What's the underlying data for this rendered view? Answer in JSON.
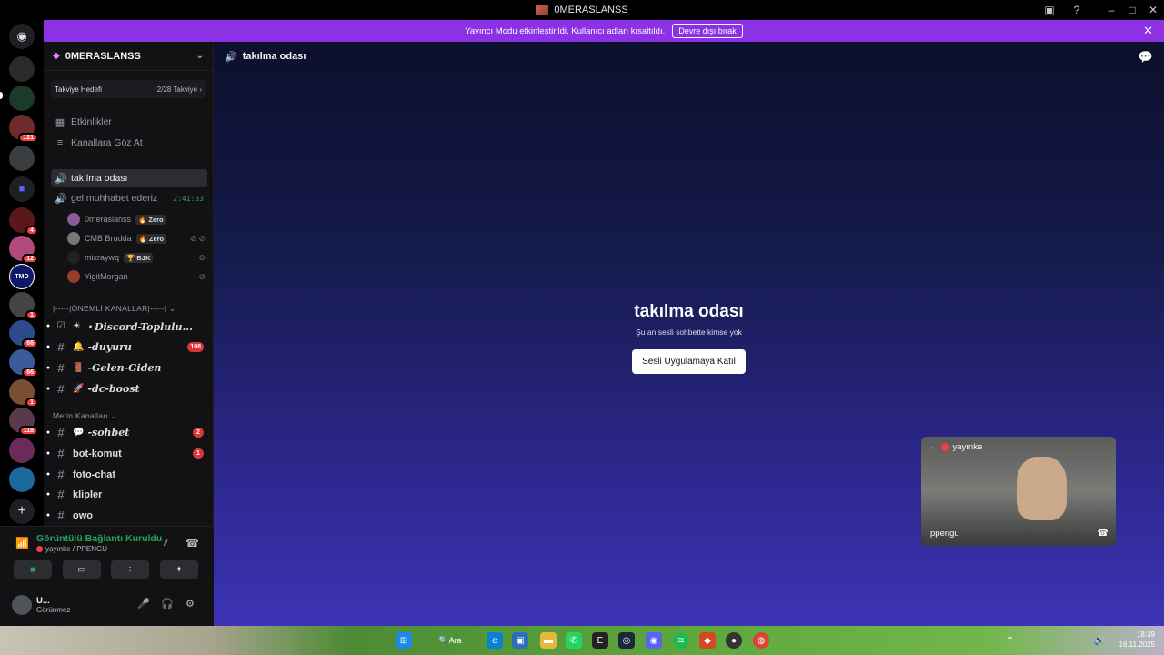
{
  "window": {
    "title": "0MERASLANSS"
  },
  "banner": {
    "message": "Yayıncı Modu etkinleştirildi. Kullanıcı adları kısaltıldı.",
    "button": "Devre dışı bırak"
  },
  "rail_badges": [
    "121",
    "4",
    "12",
    "1",
    "66",
    "66",
    "1",
    "118"
  ],
  "rail_labels": {
    "tmd": "TMD"
  },
  "server": {
    "name": "0MERASLANSS",
    "boost_label": "Takviye Hedefi",
    "boost_value": "2/28 Takviye",
    "links": [
      {
        "label": "Etkinlikler"
      },
      {
        "label": "Kanallara Göz At"
      }
    ]
  },
  "voice_channels": [
    {
      "name": "takılma odası"
    },
    {
      "name": "gel muhhabet ederiz",
      "timer": "2:41:33"
    }
  ],
  "voice_users": [
    {
      "name": "0meraslanss",
      "tag": "Zero"
    },
    {
      "name": "CMB Brudda",
      "tag": "Zero"
    },
    {
      "name": "mixraywq",
      "tag": "BJK"
    },
    {
      "name": "YigitMorgan",
      "tag": ""
    }
  ],
  "category_important": "|-----|ÖNEMLİ KANALLAR|-----|",
  "important_channels": [
    {
      "emoji": "☀",
      "name": "・Discord-Toplulu...",
      "count": ""
    },
    {
      "emoji": "🔔",
      "name": "-duyuru",
      "count": "108"
    },
    {
      "emoji": "🚪",
      "name": "-Gelen-Giden",
      "count": ""
    },
    {
      "emoji": "🚀",
      "name": "-dc-boost",
      "count": ""
    }
  ],
  "category_text": "Metin Kanalları",
  "text_channels": [
    {
      "emoji": "💬",
      "name": "-sohbet",
      "count": "2"
    },
    {
      "emoji": "",
      "name": "bot-komut",
      "count": "1"
    },
    {
      "emoji": "",
      "name": "foto-chat",
      "count": ""
    },
    {
      "emoji": "",
      "name": "klipler",
      "count": ""
    },
    {
      "emoji": "",
      "name": "owo",
      "count": ""
    }
  ],
  "voice_panel": {
    "status": "Görüntülü Bağlantı Kuruldu",
    "sub": "yayınke / PPENGU"
  },
  "user_panel": {
    "name": "U...",
    "status": "Görünmez"
  },
  "main": {
    "channel_name": "takılma odası",
    "heading": "takılma odası",
    "subtitle": "Şu an sesli sohbette kimse yok",
    "join_button": "Sesli Uygulamaya Katıl"
  },
  "pip": {
    "title": "yayınke",
    "name": "ppengu"
  },
  "taskbar": {
    "search": "Ara",
    "time": "18:39",
    "date": "16.11.2025"
  },
  "colors": {
    "accent": "#8c31e4",
    "online": "#23a55a",
    "badge": "#f23f43"
  }
}
